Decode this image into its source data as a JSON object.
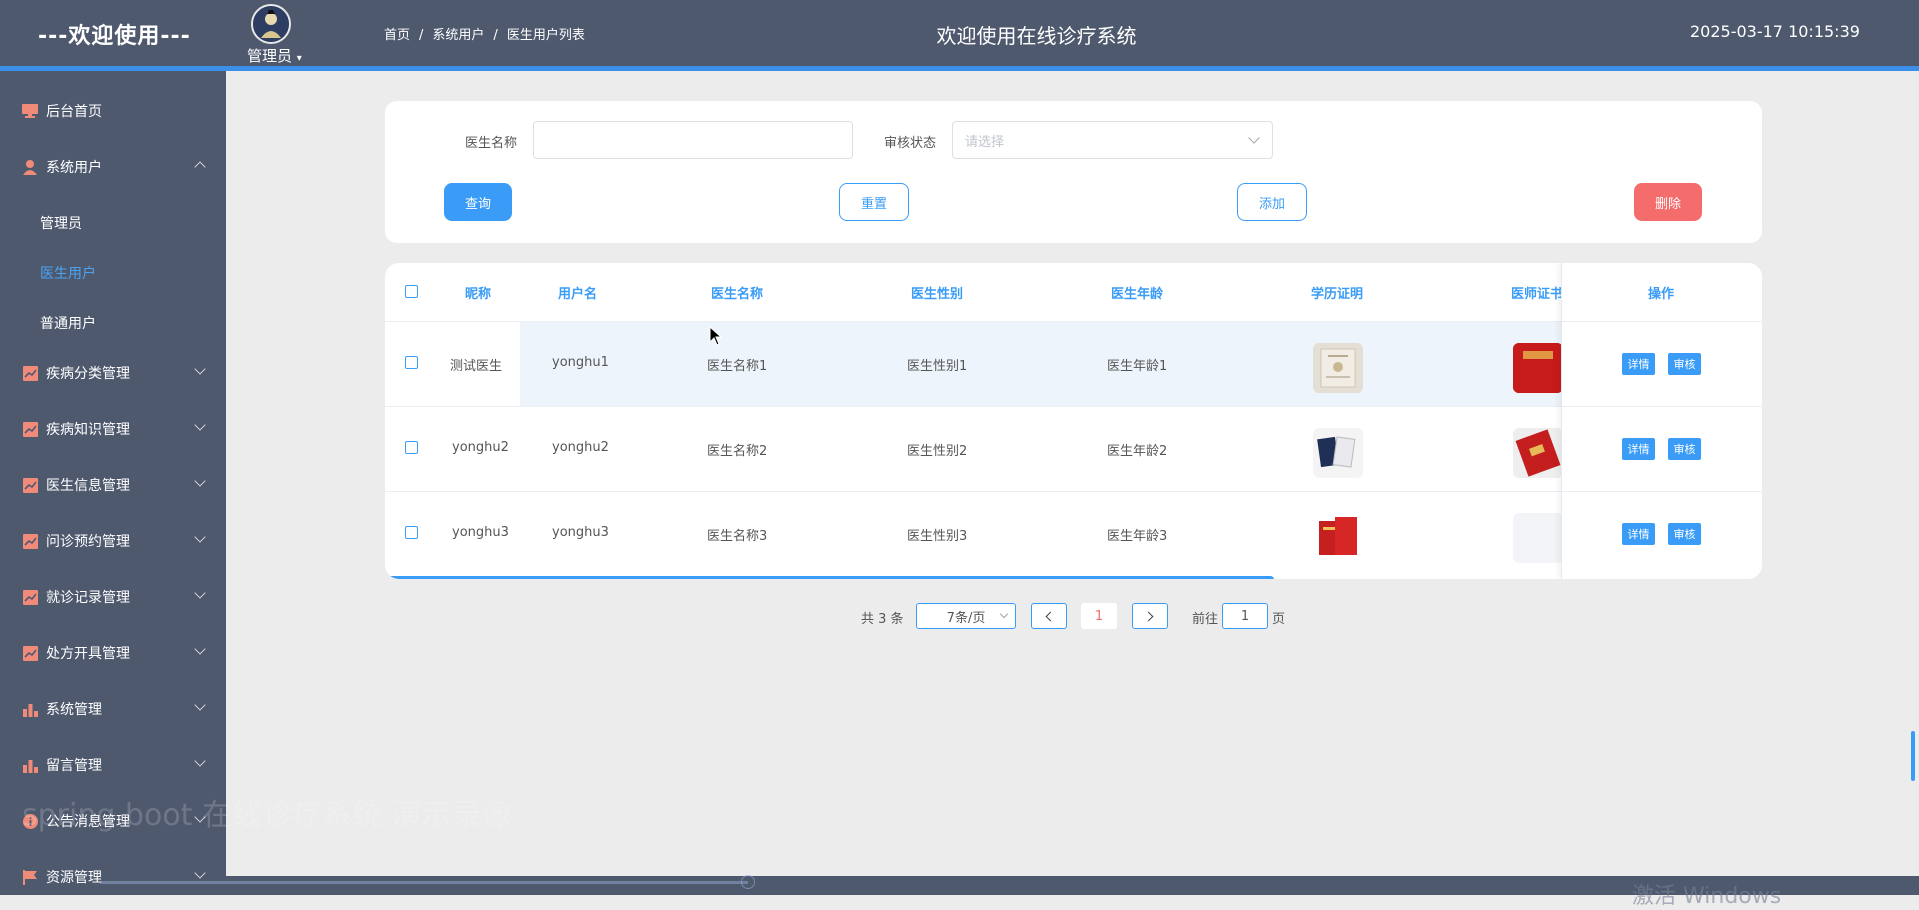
{
  "header": {
    "brand": "---欢迎使用---",
    "role": "管理员",
    "breadcrumb": [
      "首页",
      "系统用户",
      "医生用户列表"
    ],
    "site_title": "欢迎使用在线诊疗系统",
    "datetime": "2025-03-17 10:15:39"
  },
  "sidebar": {
    "items": [
      {
        "label": "后台首页",
        "icon": "monitor-icon"
      },
      {
        "label": "系统用户",
        "icon": "user-icon",
        "expanded": true
      },
      {
        "label": "疾病分类管理",
        "icon": "chart-line-icon"
      },
      {
        "label": "疾病知识管理",
        "icon": "chart-line-icon"
      },
      {
        "label": "医生信息管理",
        "icon": "chart-line-icon"
      },
      {
        "label": "问诊预约管理",
        "icon": "chart-line-icon"
      },
      {
        "label": "就诊记录管理",
        "icon": "chart-line-icon"
      },
      {
        "label": "处方开具管理",
        "icon": "chart-line-icon"
      },
      {
        "label": "系统管理",
        "icon": "bar-chart-icon"
      },
      {
        "label": "留言管理",
        "icon": "bar-chart-icon"
      },
      {
        "label": "公告消息管理",
        "icon": "info-icon"
      },
      {
        "label": "资源管理",
        "icon": "flag-icon"
      }
    ],
    "sub_items": [
      {
        "label": "管理员",
        "active": false
      },
      {
        "label": "医生用户",
        "active": true
      },
      {
        "label": "普通用户",
        "active": false
      }
    ]
  },
  "search": {
    "doctor_name_label": "医生名称",
    "doctor_name_value": "",
    "audit_status_label": "审核状态",
    "audit_status_placeholder": "请选择",
    "query_button": "查询",
    "reset_button": "重置",
    "add_button": "添加",
    "delete_button": "删除"
  },
  "table": {
    "headers": [
      "昵称",
      "用户名",
      "医生名称",
      "医生性别",
      "医生年龄",
      "学历证明",
      "医师证书",
      "操作"
    ],
    "rows": [
      {
        "nickname": "测试医生",
        "username": "yonghu1",
        "name": "医生名称1",
        "gender": "医生性别1",
        "age": "医生年龄1"
      },
      {
        "nickname": "yonghu2",
        "username": "yonghu2",
        "name": "医生名称2",
        "gender": "医生性别2",
        "age": "医生年龄2"
      },
      {
        "nickname": "yonghu3",
        "username": "yonghu3",
        "name": "医生名称3",
        "gender": "医生性别3",
        "age": "医生年龄3"
      }
    ],
    "detail_button": "详情",
    "audit_button": "审核"
  },
  "pagination": {
    "total_text": "共 3 条",
    "page_size": "7条/页",
    "current_page": "1",
    "goto_label": "前往",
    "goto_value": "1",
    "page_suffix": "页"
  },
  "overlay": {
    "video_watermark": "spring boot 在线诊疗系统 演示录像",
    "windows_watermark": "激活 Windows"
  },
  "colors": {
    "topbar": "#4f596e",
    "accent": "#3a9cf7",
    "danger": "#f56c6c",
    "sidebar_icon": "#f08b7a"
  }
}
